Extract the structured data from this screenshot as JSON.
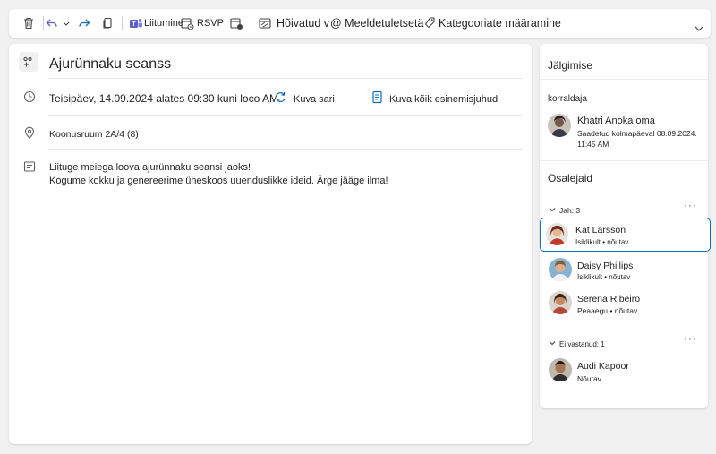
{
  "toolbar": {
    "teams_label": "Liitumine",
    "rsvp_label": "RSVP",
    "busy_label": "Hõivatud v",
    "reminder_label": "@ Meeldetuletsetä",
    "categorize_label": "Kategooriate määramine"
  },
  "event": {
    "title": "Ajurünnaku seanss",
    "datetime": "Teisipäev, 14.09.2024 alates 09:30 kuni loco AM",
    "view_series": "Kuva sari",
    "view_all_instances": "Kuva kõik esinemisjuhud",
    "location": "Koonusruum 2A/4 (8)",
    "description_line1": "Liituge meiega loova ajurünnaku seansi jaoks!",
    "description_line2": "Kogume kokku ja genereerime üheskoos uuenduslikke ideid. Ärge jääge ilma!"
  },
  "side": {
    "tracking_title": "Jälgimise",
    "organizer_label": "korraldaja",
    "organizer": {
      "name": "Khatri Anoka oma",
      "sent_line1": "Saadetud kolmapäeval 08.09.2024.",
      "sent_line2": "11:45 AM"
    },
    "attendees_title": "Osalejaid",
    "yes_group": "Jah: 3",
    "no_response_group": "Ei vastanud: 1",
    "attendees": [
      {
        "name": "Kat Larsson",
        "status": "Isiklikult • nõutav"
      },
      {
        "name": "Daisy Phillips",
        "status": "Isiklikult • nõutav"
      },
      {
        "name": "Serena Ribeiro",
        "status": "Peaaegu • nõutav"
      },
      {
        "name": "Audi Kapoor",
        "status": "Nõutav"
      }
    ],
    "more_label": "···"
  },
  "colors": {
    "accent": "#0f6cbd",
    "teams": "#5b5fc7"
  }
}
